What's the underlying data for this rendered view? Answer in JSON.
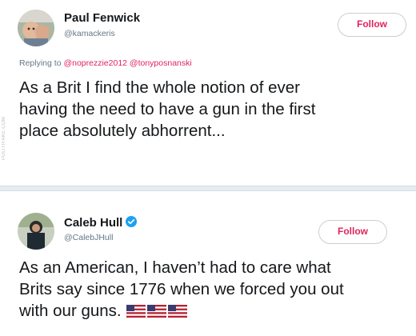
{
  "tweet1": {
    "display_name": "Paul Fenwick",
    "handle": "@kamackeris",
    "follow_label": "Follow",
    "replying_to_label": "Replying to",
    "mentions": [
      "@noprezzie2012",
      "@tonyposnanski"
    ],
    "body_lines": [
      "As a Brit I find the whole notion of ever",
      "having the need to have a gun in the first",
      "place absolutely abhorrent..."
    ]
  },
  "tweet2": {
    "display_name": "Caleb Hull",
    "handle": "@CalebJHull",
    "verified": true,
    "follow_label": "Follow",
    "body_lines": [
      "As an American, I haven’t had to care what",
      "Brits say since 1776 when we forced you out",
      "with our guns."
    ],
    "emoji": [
      "us-flag",
      "us-flag",
      "us-flag"
    ]
  },
  "watermark": "POLITIFAKE.COM",
  "colors": {
    "follow_text": "#e0245e",
    "mention": "#e0245e",
    "verified": "#1da1f2",
    "secondary_text": "#657786",
    "divider": "#e6ecf0"
  }
}
